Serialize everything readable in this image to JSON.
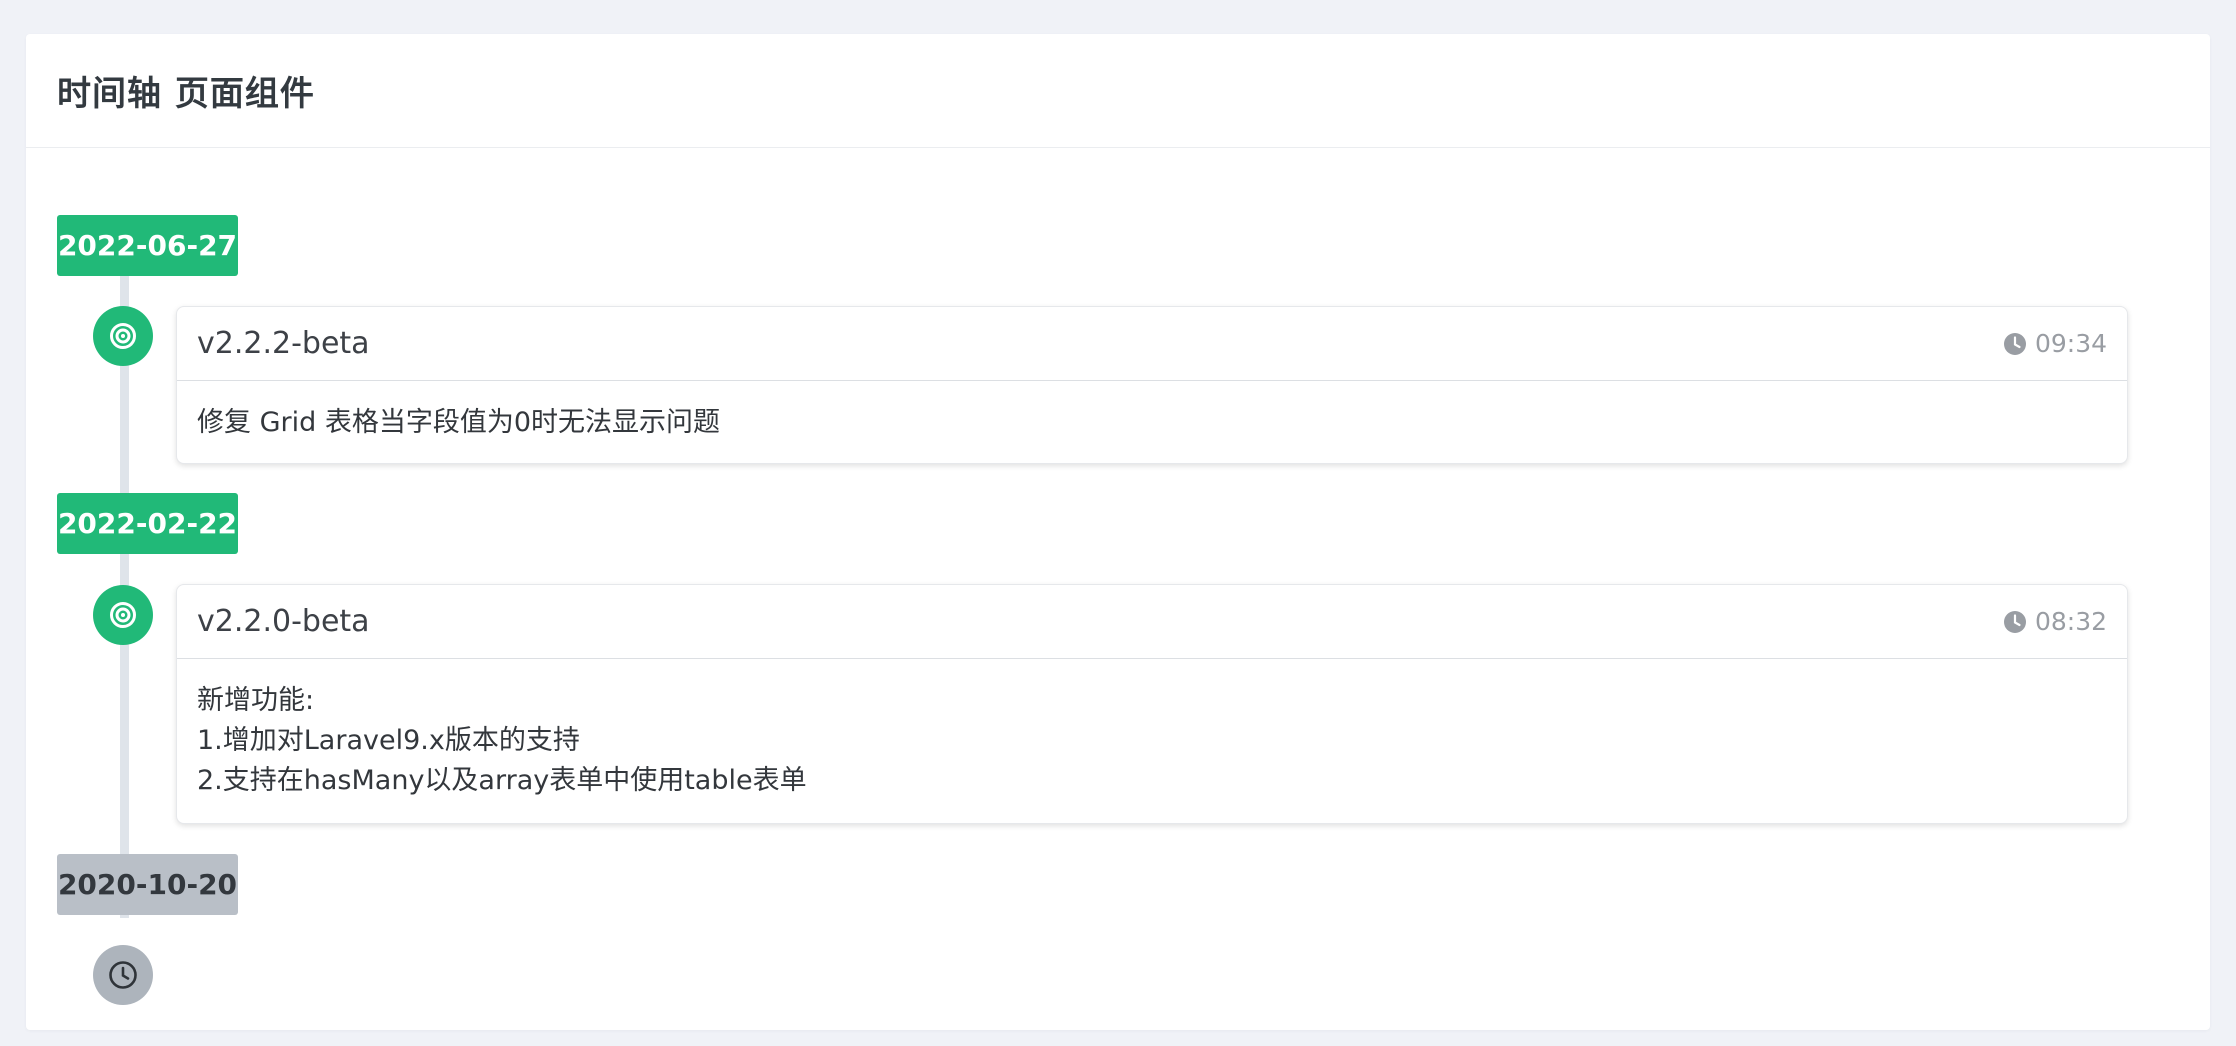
{
  "page": {
    "title": "时间轴 页面组件"
  },
  "colors": {
    "accent": "#21b978",
    "muted_label": "#b9bfc7",
    "muted_node": "#adb4bc",
    "line": "#dfe4ea"
  },
  "timeline": {
    "groups": [
      {
        "date": "2022-06-27",
        "status": "active",
        "item": {
          "title": "v2.2.2-beta",
          "time": "09:34",
          "body": [
            "修复 Grid 表格当字段值为0时无法显示问题"
          ],
          "icon": "target-icon"
        }
      },
      {
        "date": "2022-02-22",
        "status": "active",
        "item": {
          "title": "v2.2.0-beta",
          "time": "08:32",
          "body": [
            "新增功能:",
            "1.增加对Laravel9.x版本的支持",
            "2.支持在hasMany以及array表单中使用table表单"
          ],
          "icon": "target-icon"
        }
      },
      {
        "date": "2020-10-20",
        "status": "inactive",
        "end_icon": "clock-icon"
      }
    ]
  }
}
